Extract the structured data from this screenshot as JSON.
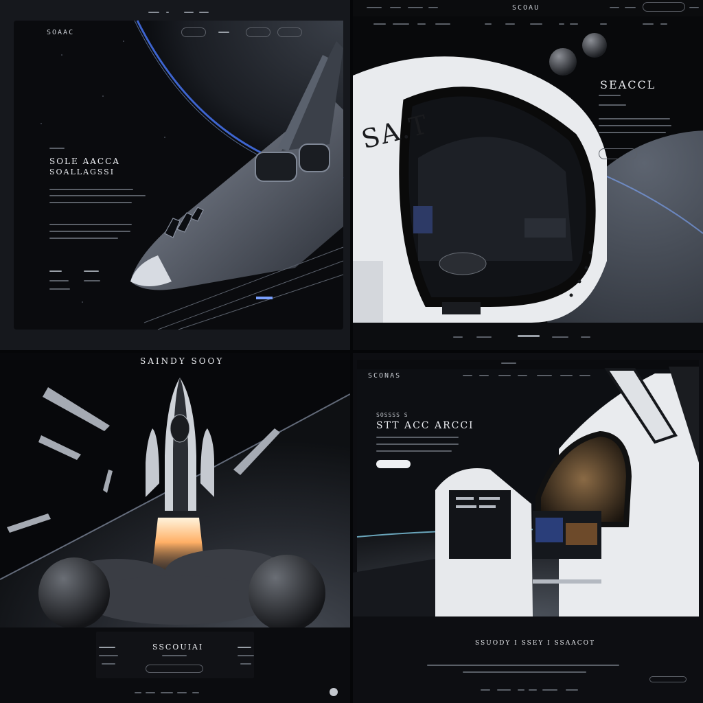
{
  "panel1": {
    "logo": "SOAAC",
    "eyebrow": "",
    "headline_line1": "SOLE AACCA",
    "headline_line2": "SOALLAGSSI"
  },
  "panel2": {
    "logo": "SCOAU",
    "side_title": "SEACCL",
    "hull_text": "SA.T"
  },
  "panel3": {
    "title": "SAINDY SOOY",
    "footer_center": "SSCOUIAI"
  },
  "panel4": {
    "logo": "SCONAS",
    "eyebrow": "SOSSSS S",
    "headline": "STT ACC ARCCI",
    "footer_title": "SSUODY I SSEY I SSAACOT"
  },
  "colors": {
    "background": "#050608",
    "accent_glow": "#4a7bff",
    "engine_flame": "#ffb066",
    "text": "#eceef2"
  }
}
